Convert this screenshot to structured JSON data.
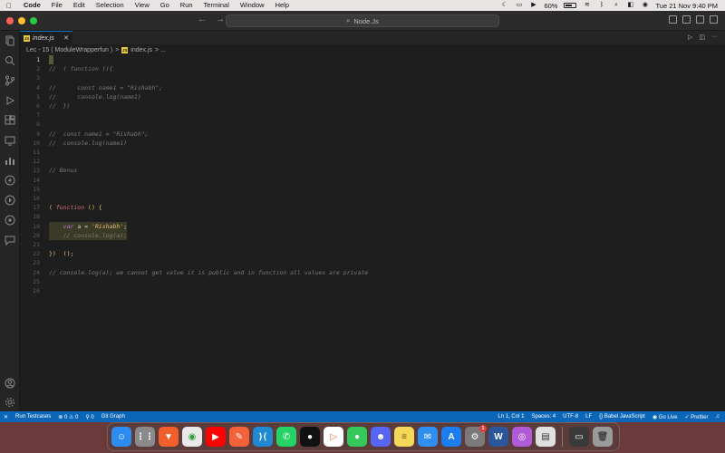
{
  "menubar": {
    "app_name": "Code",
    "items": [
      "File",
      "Edit",
      "Selection",
      "View",
      "Go",
      "Run",
      "Terminal",
      "Window",
      "Help"
    ],
    "battery": "60%",
    "clock": "Tue 21 Nov  9:40 PM"
  },
  "titlebar": {
    "search_text": "Node.Js"
  },
  "tab": {
    "label": "index.js",
    "badge": "JS",
    "close": "✕"
  },
  "breadcrumb": {
    "folder": "Lec - 15 ( ModuleWrapperfun )",
    "sep": ">",
    "file": "index.js",
    "tail": "> ..."
  },
  "editor": {
    "line_numbers": [
      "1",
      "2",
      "3",
      "4",
      "5",
      "6",
      "7",
      "8",
      "9",
      "10",
      "11",
      "12",
      "13",
      "14",
      "15",
      "16",
      "17",
      "18",
      "19",
      "20",
      "21",
      "22",
      "23",
      "24",
      "25",
      "26"
    ],
    "lines": {
      "l2": "//  ( function (){",
      "l4": "//      const name1 = \"Rishabh\";",
      "l5": "//      console.log(name1)",
      "l6": "//  })",
      "l9": "//  const name1 = \"Rishabh\";",
      "l10": "//  console.log(name1)",
      "l13": "// Bonus",
      "l17_open": "( ",
      "l17_fn": "function",
      "l17_rest": " () {",
      "l19_kw": "var",
      "l19_mid": " a = ",
      "l19_str": "'Rishabh'",
      "l19_end": ";",
      "l20": "// console.log(a);",
      "l22": "})  ();",
      "l24": "// console.log(a); we cannot get value it is public and in function all values are private"
    }
  },
  "statusbar": {
    "remote": "✕",
    "run_testcases": "Run Testcases",
    "problems": "⊗ 0 ⚠ 0",
    "ports": "⚲ 0",
    "git_graph": "Git Graph",
    "position": "Ln 1, Col 1",
    "spaces": "Spaces: 4",
    "encoding": "UTF-8",
    "eol": "LF",
    "language": "{} Babel JavaScript",
    "go_live": "Go Live",
    "prettier": "✓ Prettier"
  },
  "colors": {
    "accent": "#0b66b7",
    "editor_bg": "#1e1e1e"
  }
}
